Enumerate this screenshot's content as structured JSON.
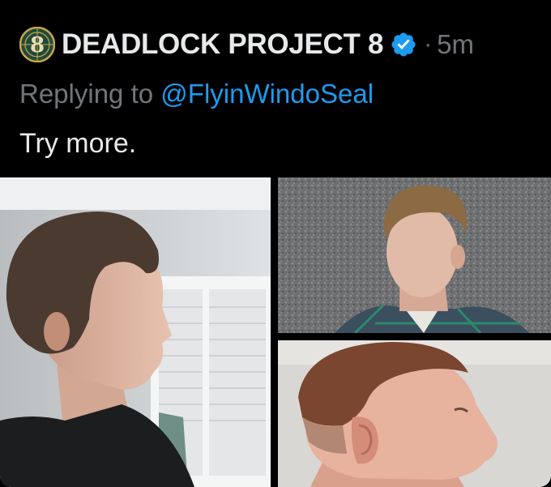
{
  "tweet": {
    "author_name": "DEADLOCK PROJECT 8",
    "avatar_glyph": "8",
    "verified_icon": "verified-badge-icon",
    "separator": "·",
    "time": "5m",
    "reply_prefix": "Replying to",
    "reply_handle": "@FlyinWindoSeal",
    "text": "Try more."
  },
  "media": {
    "photos": [
      {
        "name": "photo-side-profile-room"
      },
      {
        "name": "photo-looking-up-wall"
      },
      {
        "name": "photo-profile-fade-haircut"
      }
    ]
  },
  "colors": {
    "background": "#000000",
    "text": "#e7e9ea",
    "muted": "#71767b",
    "link": "#1d9bf0",
    "avatar_ring": "#c9a54a",
    "avatar_bg": "#1f4a3b"
  }
}
